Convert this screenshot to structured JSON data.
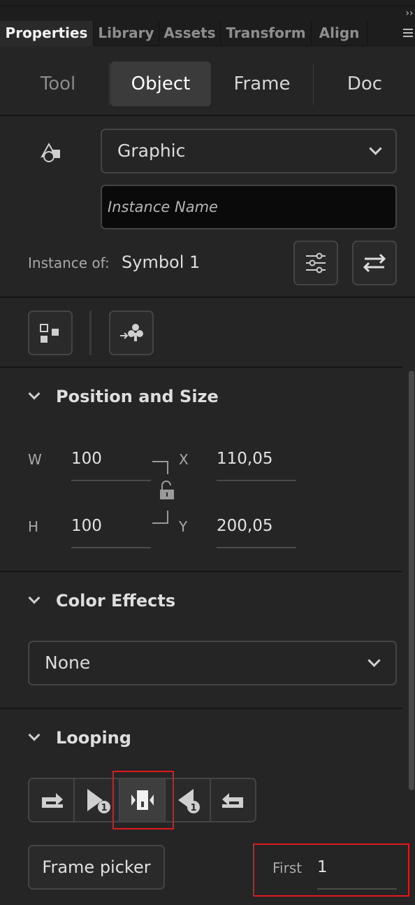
{
  "tabs": [
    {
      "label": "Properties",
      "active": true
    },
    {
      "label": "Library",
      "active": false
    },
    {
      "label": "Assets",
      "active": false
    },
    {
      "label": "Transform",
      "active": false
    },
    {
      "label": "Align",
      "active": false
    }
  ],
  "collapse_glyph": "››",
  "segments": [
    {
      "label": "Tool",
      "active": false
    },
    {
      "label": "Object",
      "active": true
    },
    {
      "label": "Frame",
      "active": false
    },
    {
      "label": "Doc",
      "active": false
    }
  ],
  "object": {
    "type_icon": "shape-type-icon",
    "instance_behavior": "Graphic",
    "instance_name_placeholder": "Instance Name",
    "instance_of_label": "Instance of:",
    "instance_of_value": "Symbol 1",
    "edit_symbol_icon": "sliders-icon",
    "swap_symbol_icon": "swap-arrows-icon"
  },
  "tools_row": {
    "icons": [
      "distribute-grid-icon",
      "assign-club-icon"
    ]
  },
  "position_size": {
    "title": "Position and Size",
    "w_label": "W",
    "w_value": "100",
    "h_label": "H",
    "h_value": "100",
    "x_label": "X",
    "x_value": "110,05",
    "y_label": "Y",
    "y_value": "200,05",
    "lock_icon": "unlocked-padlock-icon"
  },
  "color_effects": {
    "title": "Color Effects",
    "selected": "None"
  },
  "looping": {
    "title": "Looping",
    "buttons": [
      {
        "icon": "loop-icon",
        "selected": false
      },
      {
        "icon": "play-once-icon",
        "selected": false
      },
      {
        "icon": "single-frame-icon",
        "selected": true
      },
      {
        "icon": "play-once-reverse-icon",
        "selected": false
      },
      {
        "icon": "loop-reverse-icon",
        "selected": false
      }
    ],
    "badge": "1",
    "frame_picker_label": "Frame picker",
    "first_label": "First",
    "first_value": "1"
  },
  "colors": {
    "panel_bg": "#252525",
    "highlight": "#e0191b"
  }
}
